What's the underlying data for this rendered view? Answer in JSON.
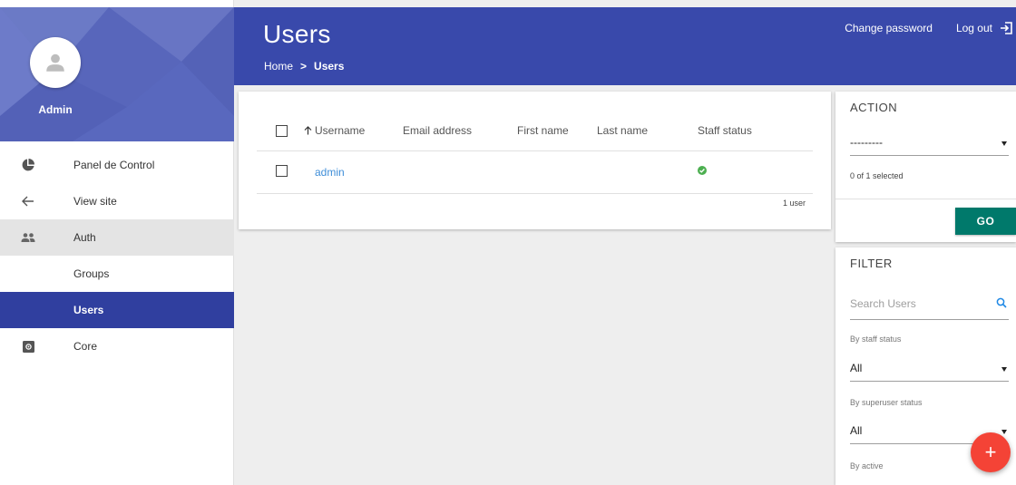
{
  "colors": {
    "sidebar_header": "#5c6bc0",
    "topbar": "#3949ab",
    "active_nav": "#303f9f",
    "link": "#3f8ed8",
    "go_button": "#00796b",
    "fab": "#f44336",
    "status_ok": "#4caf50"
  },
  "sidebar": {
    "user_name": "Admin",
    "items": [
      {
        "label": "Panel de Control",
        "icon": "pie-chart-icon"
      },
      {
        "label": "View site",
        "icon": "arrow-left-icon"
      },
      {
        "label": "Auth",
        "icon": "people-icon"
      },
      {
        "label": "Groups",
        "icon": ""
      },
      {
        "label": "Users",
        "icon": ""
      },
      {
        "label": "Core",
        "icon": "settings-box-icon"
      }
    ]
  },
  "header": {
    "title": "Users",
    "breadcrumb": {
      "home": "Home",
      "separator": ">",
      "current": "Users"
    },
    "change_password": "Change password",
    "logout": "Log out"
  },
  "results": {
    "columns": [
      "Username",
      "Email address",
      "First name",
      "Last name",
      "Staff status"
    ],
    "rows": [
      {
        "username": "admin",
        "email": "",
        "first_name": "",
        "last_name": "",
        "staff_status": true
      }
    ],
    "paginator": "1 user"
  },
  "action_panel": {
    "title": "ACTION",
    "selected_value": "---------",
    "selected_count": "0 of 1 selected",
    "go_label": "GO"
  },
  "filter_panel": {
    "title": "FILTER",
    "search_placeholder": "Search Users",
    "filters": [
      {
        "label": "By staff status",
        "value": "All"
      },
      {
        "label": "By superuser status",
        "value": "All"
      },
      {
        "label": "By active",
        "value": ""
      }
    ]
  },
  "fab": {
    "label": "+"
  }
}
